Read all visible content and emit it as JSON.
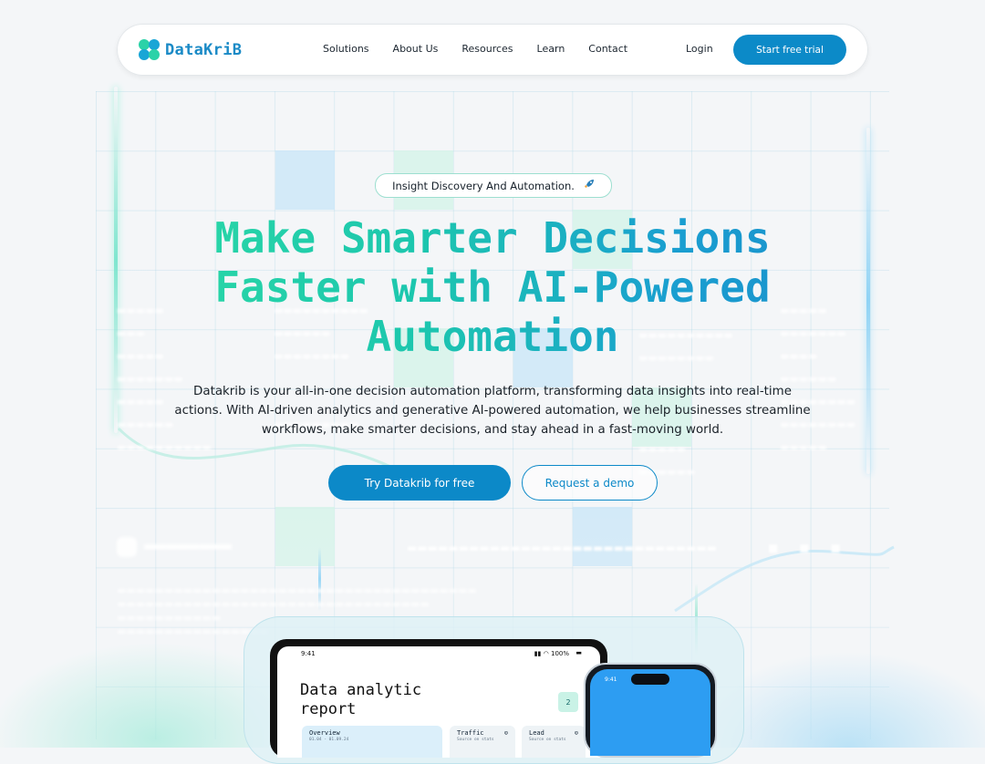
{
  "brand": {
    "name": "DataKriB",
    "colors": {
      "primary": "#0c89c8",
      "accent_green": "#2bd9a5"
    }
  },
  "nav": {
    "links": [
      "Solutions",
      "About Us",
      "Resources",
      "Learn",
      "Contact"
    ],
    "login": "Login",
    "cta": "Start free trial"
  },
  "hero": {
    "badge": "Insight Discovery And Automation.",
    "badge_icon": "rocket-icon",
    "headline_lines": [
      "Make Smarter Decisions",
      "Faster with AI-Powered",
      "Automation"
    ],
    "subtext": "Datakrib is your all-in-one decision automation platform, transforming data insights into real-time actions. With AI-driven analytics and generative AI-powered automation, we help businesses streamline workflows, make smarter decisions, and stay ahead in a fast-moving world.",
    "primary_cta": "Try Datakrib for free",
    "secondary_cta": "Request a demo"
  },
  "preview": {
    "tablet_time": "9:41",
    "tablet_battery": "100%",
    "report_title_lines": [
      "Data  analytic",
      "report"
    ],
    "report_badge": "2",
    "cards": [
      {
        "title": "Overview",
        "sub": "01.04 - 01.09.24"
      },
      {
        "title": "Traffic",
        "sub": "Source on stats"
      },
      {
        "title": "Lead",
        "sub": "Source on stats"
      }
    ],
    "phone_time": "9:41"
  }
}
